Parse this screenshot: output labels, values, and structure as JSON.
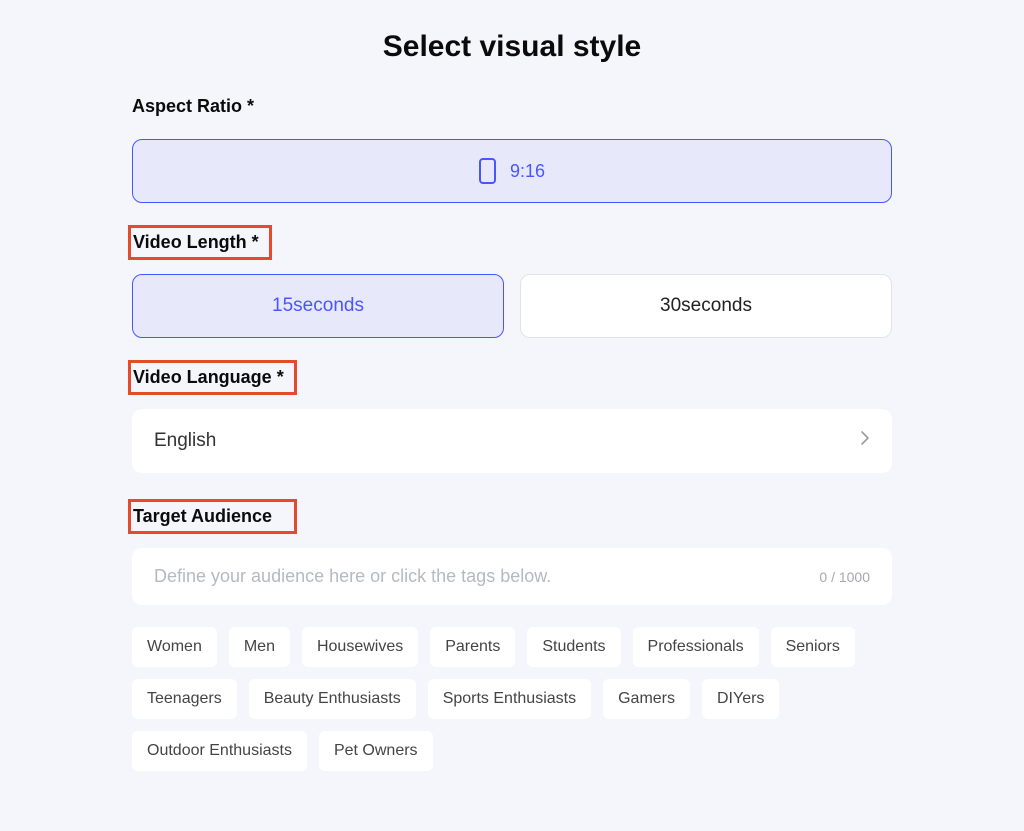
{
  "title": "Select visual style",
  "aspectRatio": {
    "label": "Aspect Ratio *",
    "options": [
      {
        "label": "9:16",
        "selected": true
      }
    ]
  },
  "videoLength": {
    "label": "Video Length *",
    "options": [
      {
        "label": "15seconds",
        "selected": true
      },
      {
        "label": "30seconds",
        "selected": false
      }
    ]
  },
  "videoLanguage": {
    "label": "Video Language *",
    "value": "English"
  },
  "targetAudience": {
    "label": "Target Audience",
    "placeholder": "Define your audience here or click the tags below.",
    "value": "",
    "counter": "0 / 1000",
    "tags": [
      "Women",
      "Men",
      "Housewives",
      "Parents",
      "Students",
      "Professionals",
      "Seniors",
      "Teenagers",
      "Beauty Enthusiasts",
      "Sports Enthusiasts",
      "Gamers",
      "DIYers",
      "Outdoor Enthusiasts",
      "Pet Owners"
    ]
  },
  "highlights": [
    "videoLength",
    "videoLanguage",
    "targetAudience"
  ]
}
